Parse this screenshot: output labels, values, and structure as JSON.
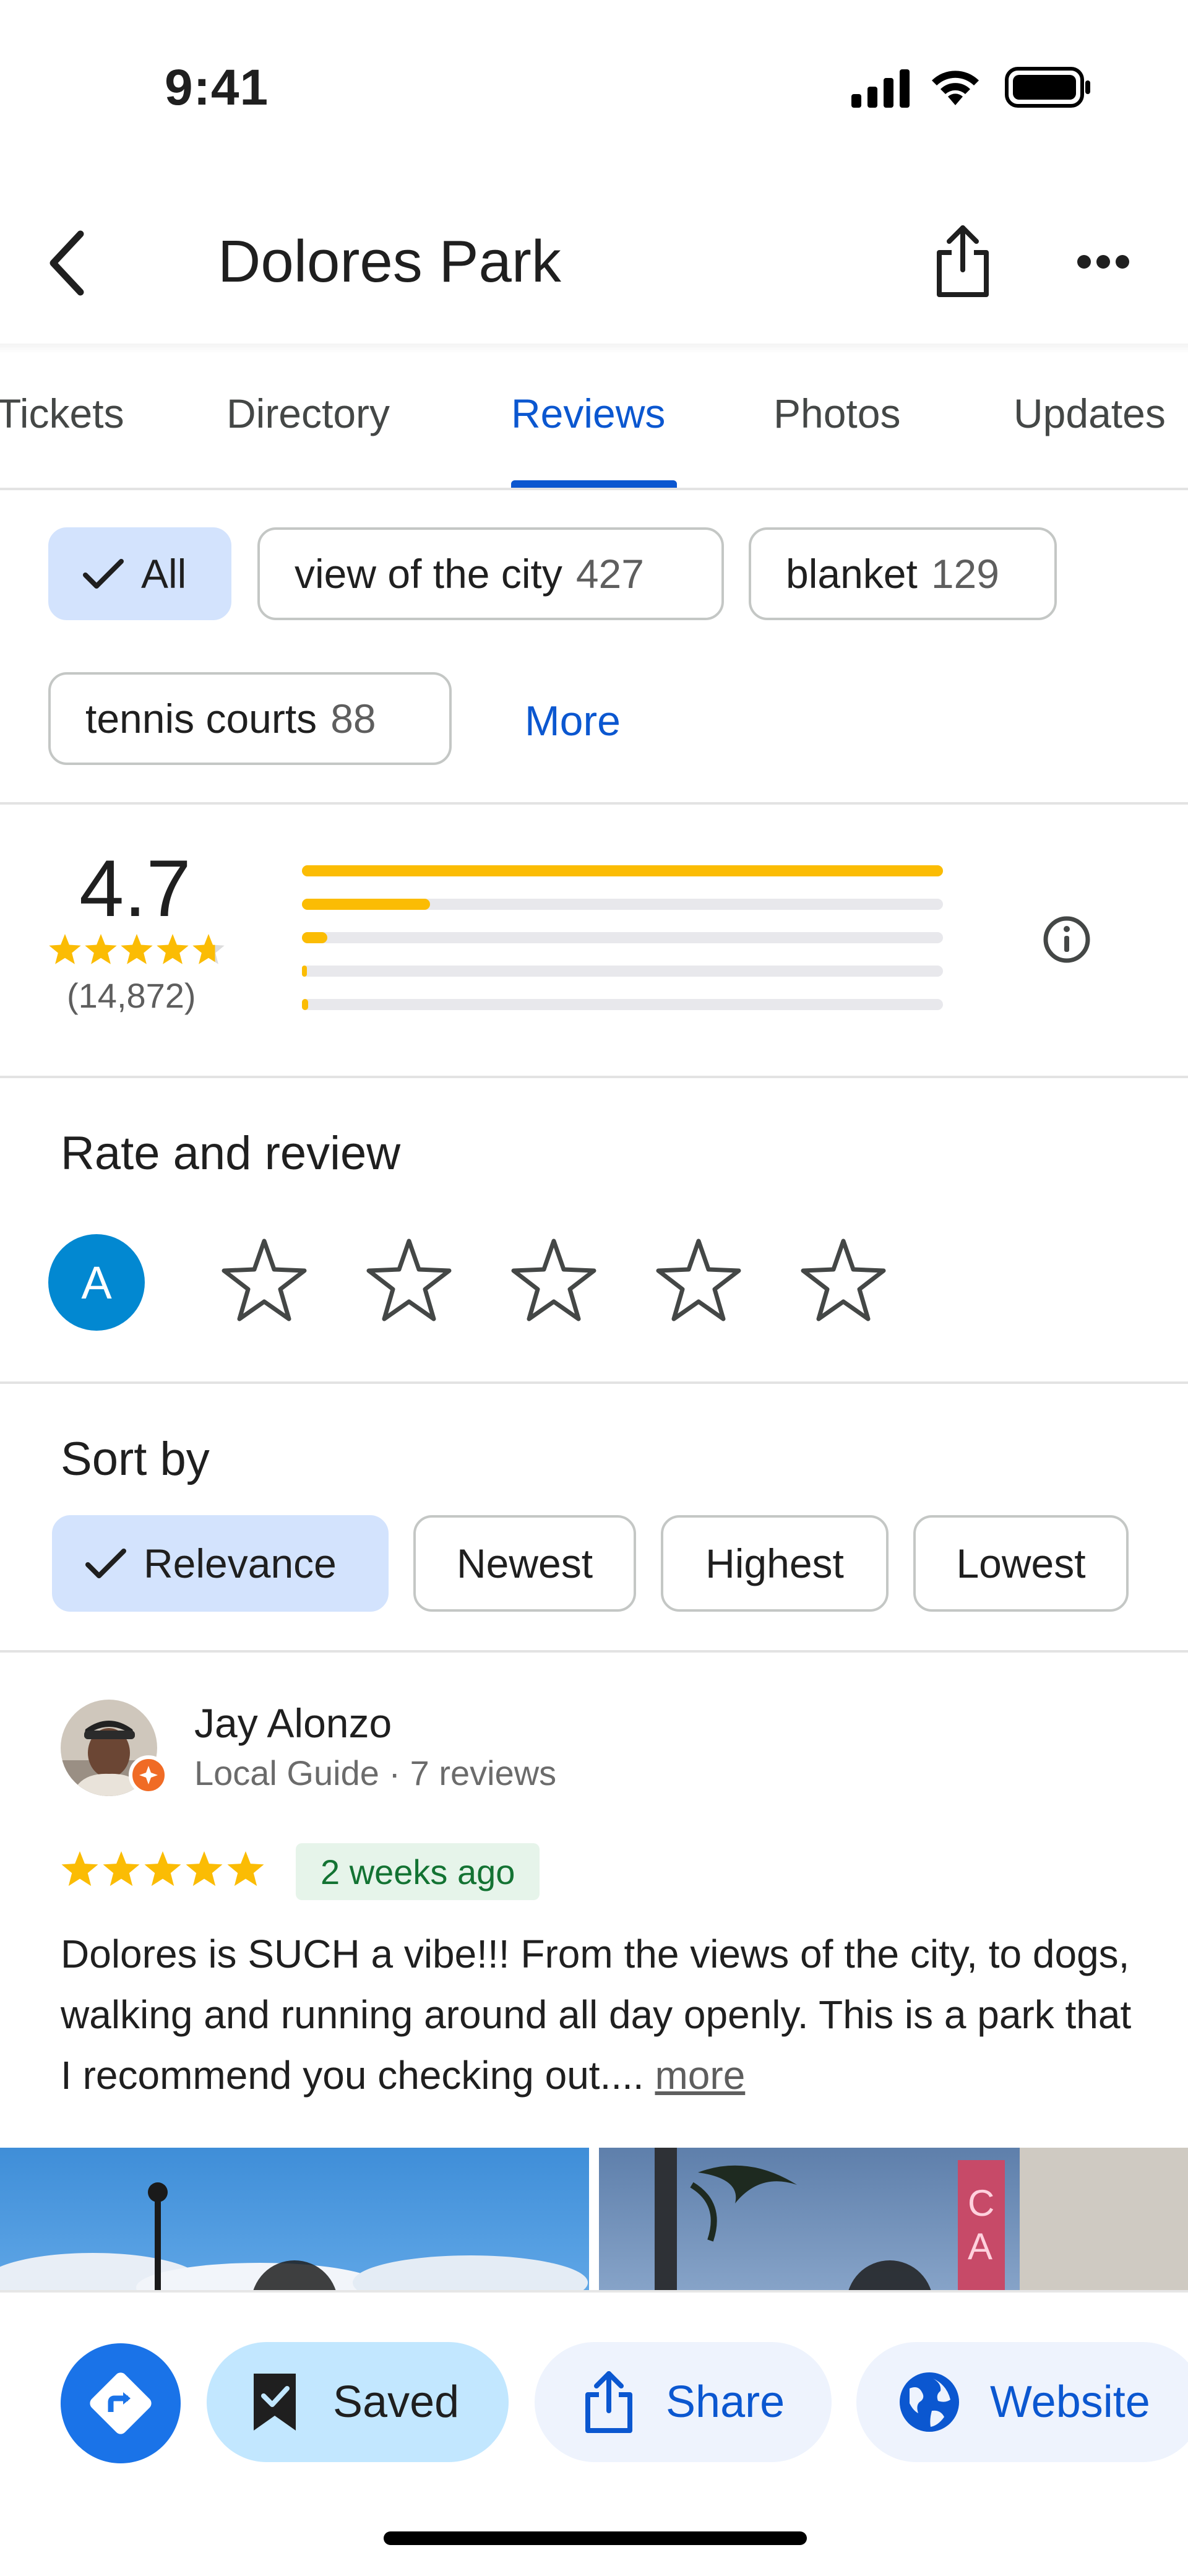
{
  "status_bar": {
    "time": "9:41"
  },
  "header": {
    "title": "Dolores Park"
  },
  "tabs": [
    {
      "label": "Tickets"
    },
    {
      "label": "Directory"
    },
    {
      "label": "Reviews"
    },
    {
      "label": "Photos"
    },
    {
      "label": "Updates"
    }
  ],
  "topics": {
    "all_label": "All",
    "items": [
      {
        "label": "view of the city",
        "count": "427"
      },
      {
        "label": "blanket",
        "count": "129"
      },
      {
        "label": "tennis courts",
        "count": "88"
      }
    ],
    "more_label": "More"
  },
  "rating": {
    "score": "4.7",
    "stars": 4.7,
    "count": "(14,872)",
    "distribution": [
      1.0,
      0.2,
      0.04,
      0.008,
      0.01
    ]
  },
  "rate_review": {
    "title": "Rate and review",
    "avatar_letter": "A"
  },
  "sort": {
    "title": "Sort by",
    "options": [
      "Relevance",
      "Newest",
      "Highest",
      "Lowest"
    ]
  },
  "review": {
    "author": "Jay Alonzo",
    "meta": "Local Guide · 7 reviews",
    "stars": 5,
    "time": "2 weeks ago",
    "text": "Dolores is SUCH a vibe!!! From the views of the city, to dogs, walking and running around all day openly. This is a park that I recommend you checking out....",
    "more_label": "more"
  },
  "actions": {
    "saved": "Saved",
    "share": "Share",
    "website": "Website"
  },
  "colors": {
    "accent": "#0b57d0",
    "star": "#fbbc04",
    "chip_selected": "#d3e3fd",
    "directions": "#1a73e8",
    "avatar": "#0288d1"
  }
}
